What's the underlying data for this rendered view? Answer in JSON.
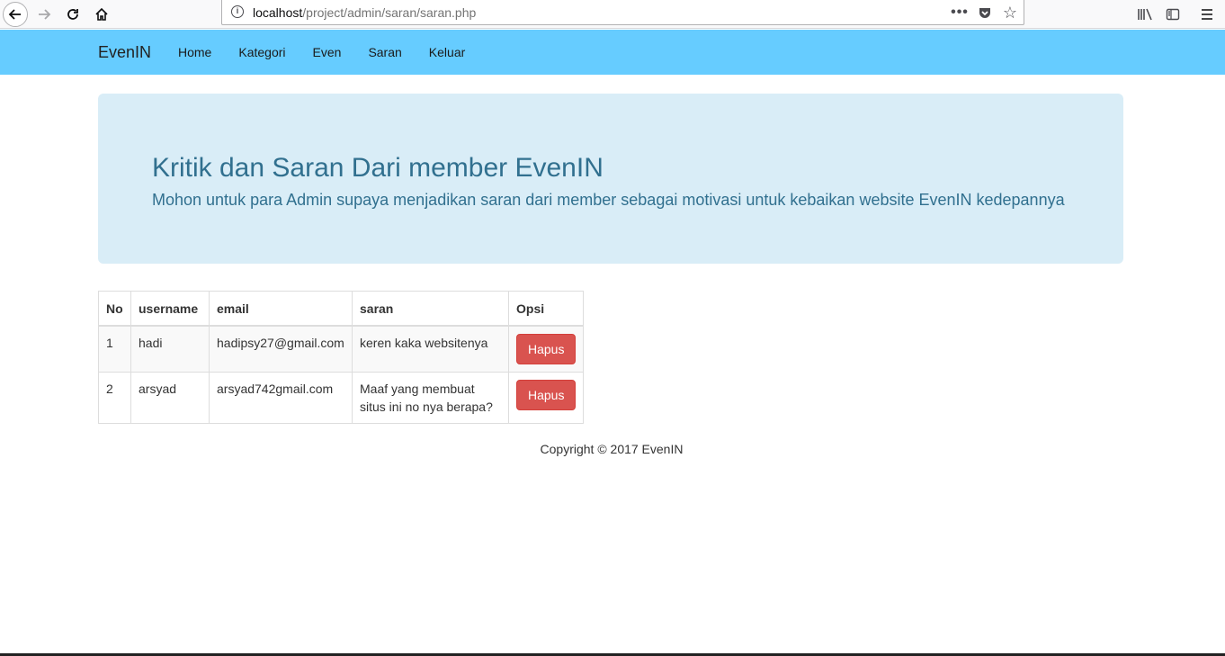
{
  "browser": {
    "url_host": "localhost",
    "url_path": "/project/admin/saran/saran.php",
    "icons": [
      "back-icon",
      "forward-icon",
      "reload-icon",
      "home-icon",
      "info-icon",
      "more-icon",
      "pocket-icon",
      "star-icon",
      "library-icon",
      "sidebar-icon",
      "menu-icon"
    ]
  },
  "navbar": {
    "brand": "EvenIN",
    "items": [
      {
        "label": "Home"
      },
      {
        "label": "Kategori"
      },
      {
        "label": "Even"
      },
      {
        "label": "Saran"
      },
      {
        "label": "Keluar"
      }
    ],
    "background": "#66ccff"
  },
  "jumbotron": {
    "title": "Kritik dan Saran Dari member EvenIN",
    "subtitle": "Mohon untuk para Admin supaya menjadikan saran dari member sebagai motivasi untuk kebaikan website EvenIN kedepannya"
  },
  "table": {
    "headers": [
      "No",
      "username",
      "email",
      "saran",
      "Opsi"
    ],
    "rows": [
      {
        "no": "1",
        "username": "hadi",
        "email": "hadipsy27@gmail.com",
        "saran": "keren kaka websitenya",
        "action": "Hapus"
      },
      {
        "no": "2",
        "username": "arsyad",
        "email": "arsyad742gmail.com",
        "saran": "Maaf yang membuat situs ini no nya berapa?",
        "action": "Hapus"
      }
    ]
  },
  "footer": {
    "text": "Copyright © 2017 EvenIN"
  }
}
